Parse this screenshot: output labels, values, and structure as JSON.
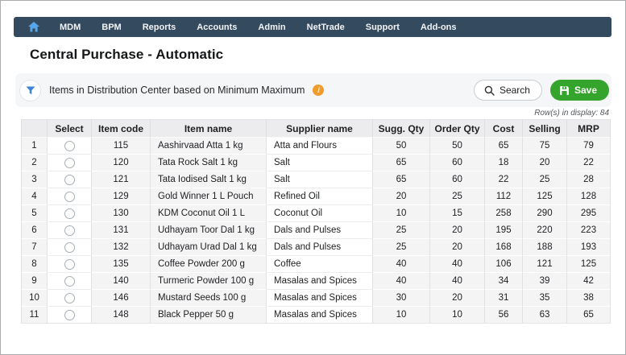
{
  "nav": {
    "items": [
      "MDM",
      "BPM",
      "Reports",
      "Accounts",
      "Admin",
      "NetTrade",
      "Support",
      "Add-ons"
    ]
  },
  "page": {
    "title": "Central Purchase - Automatic"
  },
  "filter_bar": {
    "label": "Items in Distribution Center based on Minimum Maximum",
    "info_icon": "info-icon",
    "search_label": "Search",
    "save_label": "Save",
    "rows_in_display": "Row(s) in display: 84"
  },
  "colors": {
    "nav_bg": "#344a5e",
    "home_icon_blue": "#58a6ea",
    "funnel_blue": "#3e83d6",
    "info_orange": "#f09b2e",
    "save_green": "#35a42d"
  },
  "table": {
    "headers": [
      "",
      "Select",
      "Item code",
      "Item name",
      "Supplier name",
      "Sugg. Qty",
      "Order Qty",
      "Cost",
      "Selling",
      "MRP"
    ],
    "rows": [
      {
        "sno": "1",
        "item_code": "115",
        "item_name": "Aashirvaad Atta 1 kg",
        "supplier": "Atta and Flours",
        "sugg_qty": "50",
        "order_qty": "50",
        "cost": "65",
        "selling": "75",
        "mrp": "79"
      },
      {
        "sno": "2",
        "item_code": "120",
        "item_name": "Tata Rock Salt 1 kg",
        "supplier": "Salt",
        "sugg_qty": "65",
        "order_qty": "60",
        "cost": "18",
        "selling": "20",
        "mrp": "22"
      },
      {
        "sno": "3",
        "item_code": "121",
        "item_name": "Tata Iodised Salt 1 kg",
        "supplier": "Salt",
        "sugg_qty": "65",
        "order_qty": "60",
        "cost": "22",
        "selling": "25",
        "mrp": "28"
      },
      {
        "sno": "4",
        "item_code": "129",
        "item_name": "Gold Winner 1 L Pouch",
        "supplier": "Refined Oil",
        "sugg_qty": "20",
        "order_qty": "25",
        "cost": "112",
        "selling": "125",
        "mrp": "128"
      },
      {
        "sno": "5",
        "item_code": "130",
        "item_name": "KDM Coconut Oil 1 L",
        "supplier": "Coconut Oil",
        "sugg_qty": "10",
        "order_qty": "15",
        "cost": "258",
        "selling": "290",
        "mrp": "295"
      },
      {
        "sno": "6",
        "item_code": "131",
        "item_name": "Udhayam Toor Dal 1 kg",
        "supplier": "Dals and Pulses",
        "sugg_qty": "25",
        "order_qty": "20",
        "cost": "195",
        "selling": "220",
        "mrp": "223"
      },
      {
        "sno": "7",
        "item_code": "132",
        "item_name": "Udhayam Urad Dal 1 kg",
        "supplier": "Dals and Pulses",
        "sugg_qty": "25",
        "order_qty": "20",
        "cost": "168",
        "selling": "188",
        "mrp": "193"
      },
      {
        "sno": "8",
        "item_code": "135",
        "item_name": "Coffee Powder 200 g",
        "supplier": "Coffee",
        "sugg_qty": "40",
        "order_qty": "40",
        "cost": "106",
        "selling": "121",
        "mrp": "125"
      },
      {
        "sno": "9",
        "item_code": "140",
        "item_name": "Turmeric Powder 100 g",
        "supplier": "Masalas and Spices",
        "sugg_qty": "40",
        "order_qty": "40",
        "cost": "34",
        "selling": "39",
        "mrp": "42"
      },
      {
        "sno": "10",
        "item_code": "146",
        "item_name": "Mustard Seeds 100 g",
        "supplier": "Masalas and Spices",
        "sugg_qty": "30",
        "order_qty": "20",
        "cost": "31",
        "selling": "35",
        "mrp": "38"
      },
      {
        "sno": "11",
        "item_code": "148",
        "item_name": "Black Pepper 50 g",
        "supplier": "Masalas and Spices",
        "sugg_qty": "10",
        "order_qty": "10",
        "cost": "56",
        "selling": "63",
        "mrp": "65"
      }
    ]
  }
}
